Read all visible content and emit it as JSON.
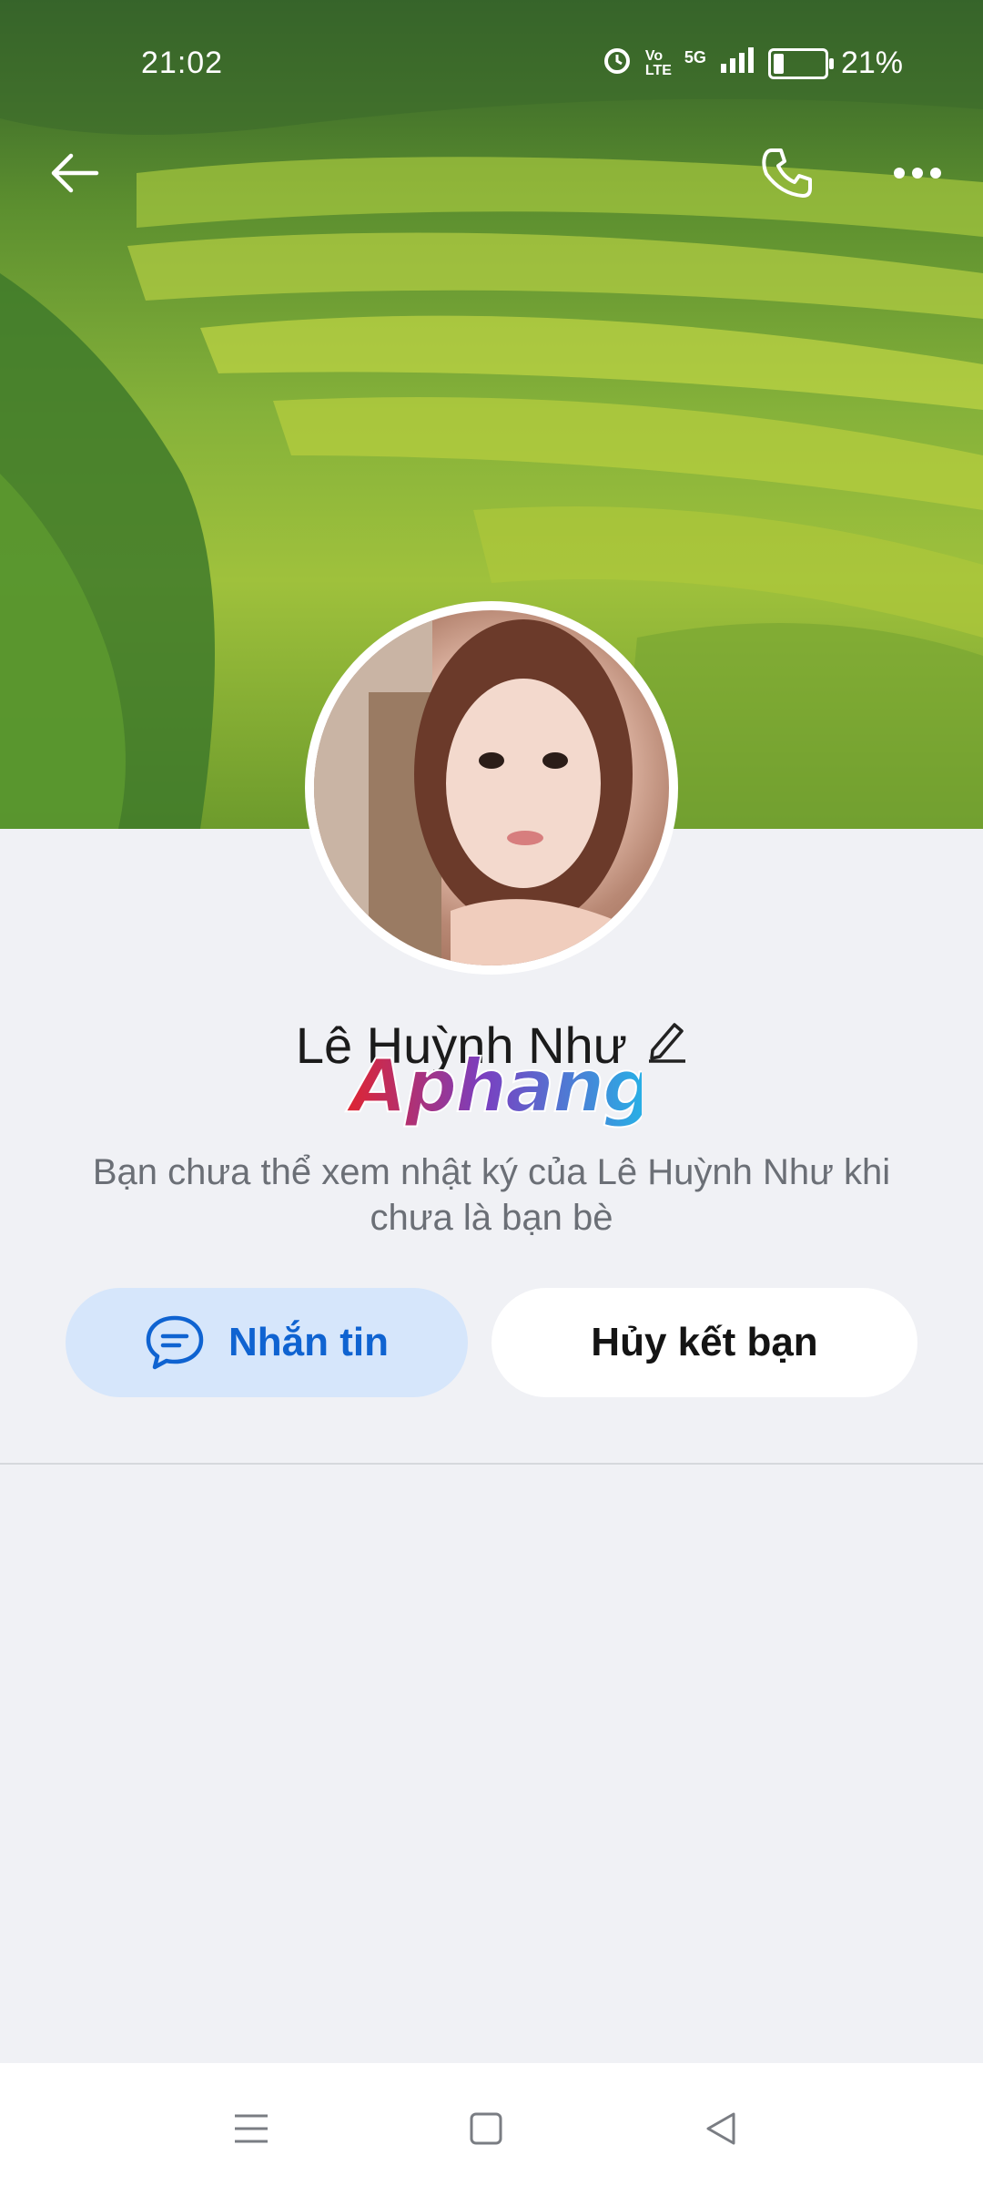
{
  "status_bar": {
    "time": "21:02",
    "network": "5G",
    "battery_percent": "21%",
    "battery_level": 0.21
  },
  "profile": {
    "name": "Lê Huỳnh Như",
    "watermark_text": "Aphang",
    "notice": "Bạn chưa thể xem nhật ký của Lê Huỳnh Như khi chưa là bạn bè"
  },
  "actions": {
    "message_label": "Nhắn tin",
    "unfriend_label": "Hủy kết bạn"
  },
  "colors": {
    "primary": "#0f63d1",
    "message_bg": "#d6e6fb",
    "page_bg": "#f0f1f5"
  }
}
